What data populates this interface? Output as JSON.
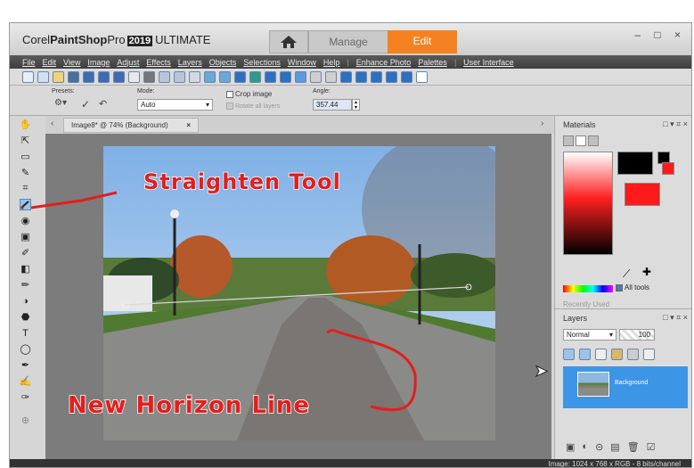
{
  "app": {
    "brand_prefix": "Corel",
    "brand_name": "PaintShop",
    "brand_pro": "Pro",
    "year": "2019",
    "edition": "ULTIMATE"
  },
  "tabs": {
    "manage": "Manage",
    "edit": "Edit"
  },
  "window_controls": "– □ ×",
  "menu": [
    "File",
    "Edit",
    "View",
    "Image",
    "Adjust",
    "Effects",
    "Layers",
    "Objects",
    "Selections",
    "Window",
    "Help",
    "Enhance Photo",
    "Palettes",
    "User Interface"
  ],
  "options": {
    "presets_label": "Presets:",
    "mode_label": "Mode:",
    "mode_value": "Auto",
    "crop_label": "Crop image",
    "rotate_label": "Rotate all layers",
    "angle_label": "Angle:",
    "angle_value": "357.44"
  },
  "document": {
    "tab_title": "Image8* @ 74% (Background)",
    "close": "×"
  },
  "materials": {
    "title": "Materials",
    "all_tools": "All tools",
    "recently_used": "Recently Used",
    "recent_colors": [
      "#000000",
      "#ffffff",
      "#ffff66",
      "#ffffff",
      "#ff2020",
      "#22dd22",
      "#ff22ff",
      "#22ddff",
      "#2244ff",
      "#ffcc00"
    ],
    "foreground": "#000000",
    "background": "#ff1a1a"
  },
  "layers": {
    "title": "Layers",
    "blend_mode": "Normal",
    "opacity": "100",
    "layer_name": "Background"
  },
  "status": {
    "image_info": "Image: 1024 x 768 x RGB - 8 bits/channel"
  },
  "annotations": {
    "tool_callout": "Straighten Tool",
    "line_callout": "New Horizon Line",
    "color": "#e31e1e"
  }
}
